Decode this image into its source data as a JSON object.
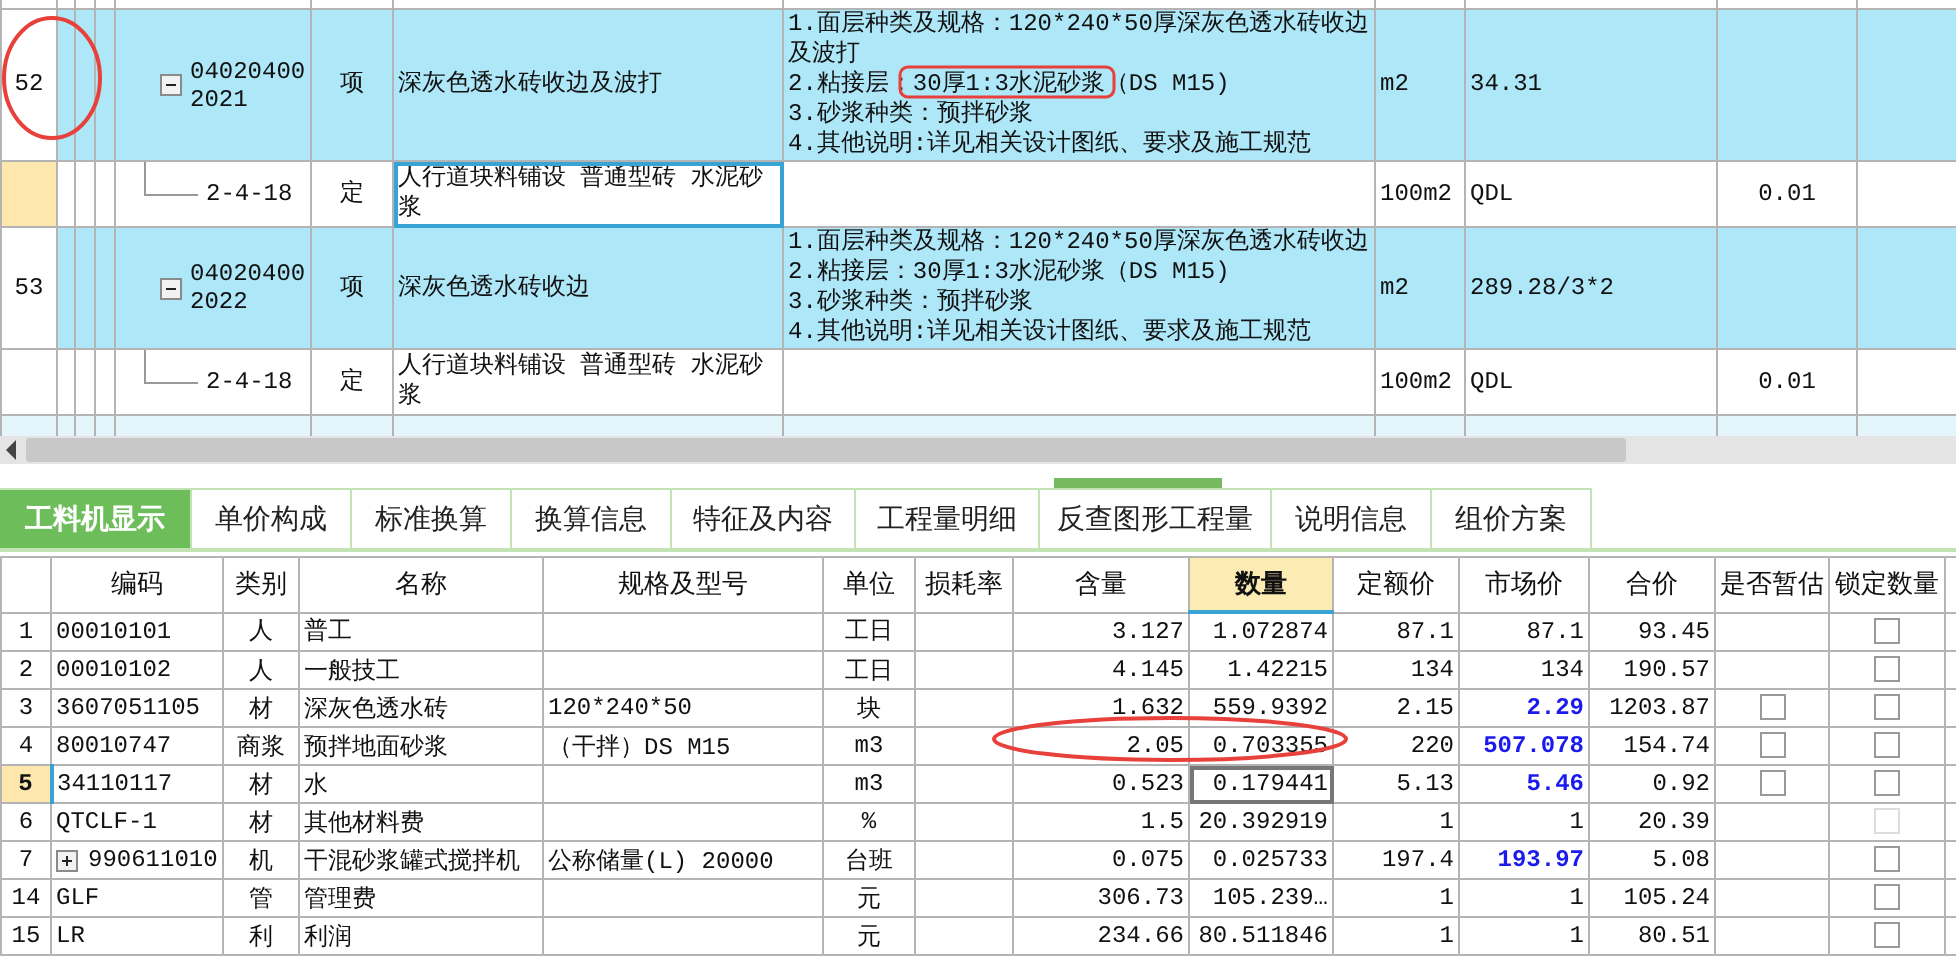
{
  "grid": {
    "rows": [
      {
        "kind": "item",
        "number": "52",
        "code": "040204002021",
        "expanded": true,
        "type": "项",
        "name": "深灰色透水砖收边及波打",
        "features": [
          "1.面层种类及规格：120*240*50厚深灰色透水砖收边及波打",
          "2.粘接层：30厚1:3水泥砂浆（DS M15)",
          "3.砂浆种类：预拌砂浆",
          "4.其他说明:详见相关设计图纸、要求及施工规范"
        ],
        "unit": "m2",
        "expression": "34.31",
        "selected": false
      },
      {
        "kind": "quota",
        "code": "2-4-18",
        "type": "定",
        "name": "人行道块料铺设 普通型砖 水泥砂浆",
        "unit": "100m2",
        "expression": "QDL",
        "quantity": "0.01",
        "selected": true
      },
      {
        "kind": "item",
        "number": "53",
        "code": "040204002022",
        "expanded": true,
        "type": "项",
        "name": "深灰色透水砖收边",
        "features": [
          "1.面层种类及规格：120*240*50厚深灰色透水砖收边",
          "2.粘接层：30厚1:3水泥砂浆（DS M15)",
          "3.砂浆种类：预拌砂浆",
          "4.其他说明:详见相关设计图纸、要求及施工规范"
        ],
        "unit": "m2",
        "expression": "289.28/3*2",
        "selected": false
      },
      {
        "kind": "quota",
        "code": "2-4-18",
        "type": "定",
        "name": "人行道块料铺设 普通型砖 水泥砂浆",
        "unit": "100m2",
        "expression": "QDL",
        "quantity": "0.01",
        "selected": false
      }
    ]
  },
  "tabs": [
    {
      "label": "工料机显示",
      "selected": true
    },
    {
      "label": "单价构成",
      "selected": false
    },
    {
      "label": "标准换算",
      "selected": false
    },
    {
      "label": "换算信息",
      "selected": false
    },
    {
      "label": "特征及内容",
      "selected": false
    },
    {
      "label": "工程量明细",
      "selected": false
    },
    {
      "label": "反查图形工程量",
      "selected": false
    },
    {
      "label": "说明信息",
      "selected": false
    },
    {
      "label": "组价方案",
      "selected": false
    }
  ],
  "materials": {
    "columns": [
      {
        "label": "编码",
        "selected": false
      },
      {
        "label": "类别",
        "selected": false
      },
      {
        "label": "名称",
        "selected": false
      },
      {
        "label": "规格及型号",
        "selected": false
      },
      {
        "label": "单位",
        "selected": false
      },
      {
        "label": "损耗率",
        "selected": false
      },
      {
        "label": "含量",
        "selected": false
      },
      {
        "label": "数量",
        "selected": true
      },
      {
        "label": "定额价",
        "selected": false
      },
      {
        "label": "市场价",
        "selected": false
      },
      {
        "label": "合价",
        "selected": false
      },
      {
        "label": "是否暂估",
        "selected": false
      },
      {
        "label": "锁定数量",
        "selected": false
      }
    ],
    "rows": [
      {
        "number": "1",
        "code": "00010101",
        "type": "人",
        "name": "普工",
        "unit": "工日",
        "content": "3.127",
        "quantity": "1.072874",
        "quota_price": "87.1",
        "market_price": "87.1",
        "price_changed": false,
        "total": "93.45",
        "locked": false,
        "lock_disabled": false,
        "selected": false
      },
      {
        "number": "2",
        "code": "00010102",
        "type": "人",
        "name": "一般技工",
        "unit": "工日",
        "content": "4.145",
        "quantity": "1.42215",
        "quota_price": "134",
        "market_price": "134",
        "price_changed": false,
        "total": "190.57",
        "locked": false,
        "lock_disabled": false,
        "selected": false
      },
      {
        "number": "3",
        "code": "3607051105",
        "type": "材",
        "name": "深灰色透水砖",
        "spec": "120*240*50",
        "unit": "块",
        "content": "1.632",
        "quantity": "559.9392",
        "quota_price": "2.15",
        "market_price": "2.29",
        "price_changed": true,
        "total": "1203.87",
        "estimated": false,
        "locked": false,
        "lock_disabled": false,
        "selected": false
      },
      {
        "number": "4",
        "code": "80010747",
        "type": "商浆",
        "name": "预拌地面砂浆",
        "spec": "（干拌）DS M15",
        "unit": "m3",
        "content": "2.05",
        "quantity": "0.703355",
        "quota_price": "220",
        "market_price": "507.078",
        "price_changed": true,
        "total": "154.74",
        "estimated": false,
        "locked": false,
        "lock_disabled": false,
        "selected": false
      },
      {
        "number": "5",
        "code": "34110117",
        "type": "材",
        "name": "水",
        "unit": "m3",
        "content": "0.523",
        "quantity": "0.179441",
        "quota_price": "5.13",
        "market_price": "5.46",
        "price_changed": true,
        "total": "0.92",
        "estimated": false,
        "locked": false,
        "lock_disabled": false,
        "selected": true
      },
      {
        "number": "6",
        "code": "QTCLF-1",
        "type": "材",
        "name": "其他材料费",
        "unit": "%",
        "content": "1.5",
        "quantity": "20.392919",
        "quota_price": "1",
        "market_price": "1",
        "price_changed": false,
        "total": "20.39",
        "locked": false,
        "lock_disabled": true,
        "selected": false
      },
      {
        "number": "7",
        "code": "990611010",
        "expanded": false,
        "type": "机",
        "name": "干混砂浆罐式搅拌机",
        "spec": "公称储量(L) 20000",
        "unit": "台班",
        "content": "0.075",
        "quantity": "0.025733",
        "quota_price": "197.4",
        "market_price": "193.97",
        "price_changed": true,
        "total": "5.08",
        "locked": false,
        "lock_disabled": false,
        "selected": false
      },
      {
        "number": "14",
        "code": "GLF",
        "type": "管",
        "name": "管理费",
        "unit": "元",
        "content": "306.73",
        "quantity": "105.239…",
        "quota_price": "1",
        "market_price": "1",
        "price_changed": false,
        "total": "105.24",
        "locked": false,
        "lock_disabled": false,
        "selected": false
      },
      {
        "number": "15",
        "code": "LR",
        "type": "利",
        "name": "利润",
        "unit": "元",
        "content": "234.66",
        "quantity": "80.511846",
        "quota_price": "1",
        "market_price": "1",
        "price_changed": false,
        "total": "80.51",
        "locked": false,
        "lock_disabled": false,
        "selected": false
      }
    ]
  }
}
